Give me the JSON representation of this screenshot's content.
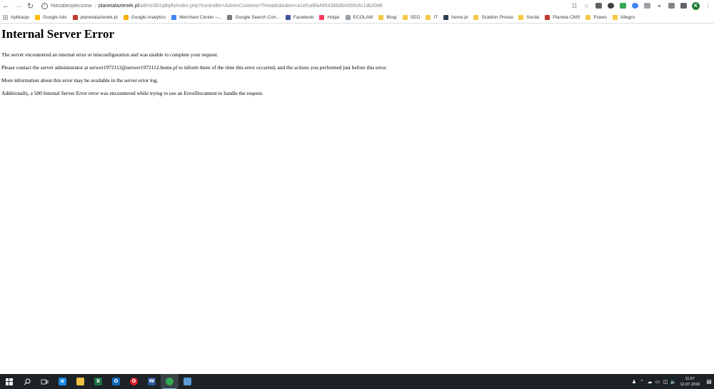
{
  "browser": {
    "security_label": "Niezabezpieczona",
    "url_host": "planetalazienek.pl",
    "url_path": "/admin351q8qifx/index.php?controller=AdminCustomerThreads&token=a1efca9fa4954386d64569c6c1db30d6",
    "profile_initial": "K"
  },
  "bookmarks": [
    {
      "label": "Aplikacje",
      "icon": "apps-icon"
    },
    {
      "label": "Google Ads",
      "icon": "google-ads-icon",
      "color": "#fbbc04"
    },
    {
      "label": "planetalazienek.pl",
      "icon": "planeta-icon",
      "color": "#c0392b"
    },
    {
      "label": "Google Analytics",
      "icon": "analytics-icon",
      "color": "#f9ab00"
    },
    {
      "label": "Merchant Center –...",
      "icon": "merchant-icon",
      "color": "#4285f4"
    },
    {
      "label": "Google Search Con...",
      "icon": "search-console-icon",
      "color": "#7a7a7a"
    },
    {
      "label": "Facebook",
      "icon": "facebook-icon",
      "color": "#3b5998"
    },
    {
      "label": "Hotjar",
      "icon": "hotjar-icon",
      "color": "#fd3a5c"
    },
    {
      "label": "ECOLAM",
      "icon": "ecolam-icon",
      "color": "#9aa0a6"
    },
    {
      "label": "Blogi",
      "icon": "folder-icon"
    },
    {
      "label": "SEO",
      "icon": "folder-icon"
    },
    {
      "label": "IT",
      "icon": "folder-icon"
    },
    {
      "label": "home.pl",
      "icon": "homepl-icon",
      "color": "#2c3e50"
    },
    {
      "label": "Szablon Presta",
      "icon": "folder-icon"
    },
    {
      "label": "Social",
      "icon": "folder-icon"
    },
    {
      "label": "Planeta CMS",
      "icon": "planeta-icon",
      "color": "#c0392b"
    },
    {
      "label": "Prawo",
      "icon": "folder-icon"
    },
    {
      "label": "Allegro",
      "icon": "folder-icon"
    }
  ],
  "page": {
    "title": "Internal Server Error",
    "paragraphs": [
      "The server encountered an internal error or misconfiguration and was unable to complete your request.",
      "Please contact the server administrator at serwer1972112@serwer1972112.home.pl to inform them of the time this error occurred, and the actions you performed just before this error.",
      "More information about this error may be available in the server error log.",
      "Additionally, a 500 Internal Server Error error was encountered while trying to use an ErrorDocument to handle the request."
    ]
  },
  "taskbar": {
    "apps": [
      {
        "name": "edge",
        "glyph": "e",
        "color": "#1e88e5"
      },
      {
        "name": "file-explorer",
        "glyph": "",
        "color": "#f0c040"
      },
      {
        "name": "excel",
        "glyph": "X",
        "color": "#1f7244"
      },
      {
        "name": "outlook",
        "glyph": "O",
        "color": "#0f6cbd"
      },
      {
        "name": "opera",
        "glyph": "O",
        "color": "#e01e26"
      },
      {
        "name": "word",
        "glyph": "W",
        "color": "#2b579a"
      },
      {
        "name": "chrome",
        "glyph": "",
        "color": "#34a853"
      },
      {
        "name": "notes",
        "glyph": "",
        "color": "#5a9bd5"
      }
    ],
    "time": "11:57",
    "date": "12.07.2019"
  }
}
